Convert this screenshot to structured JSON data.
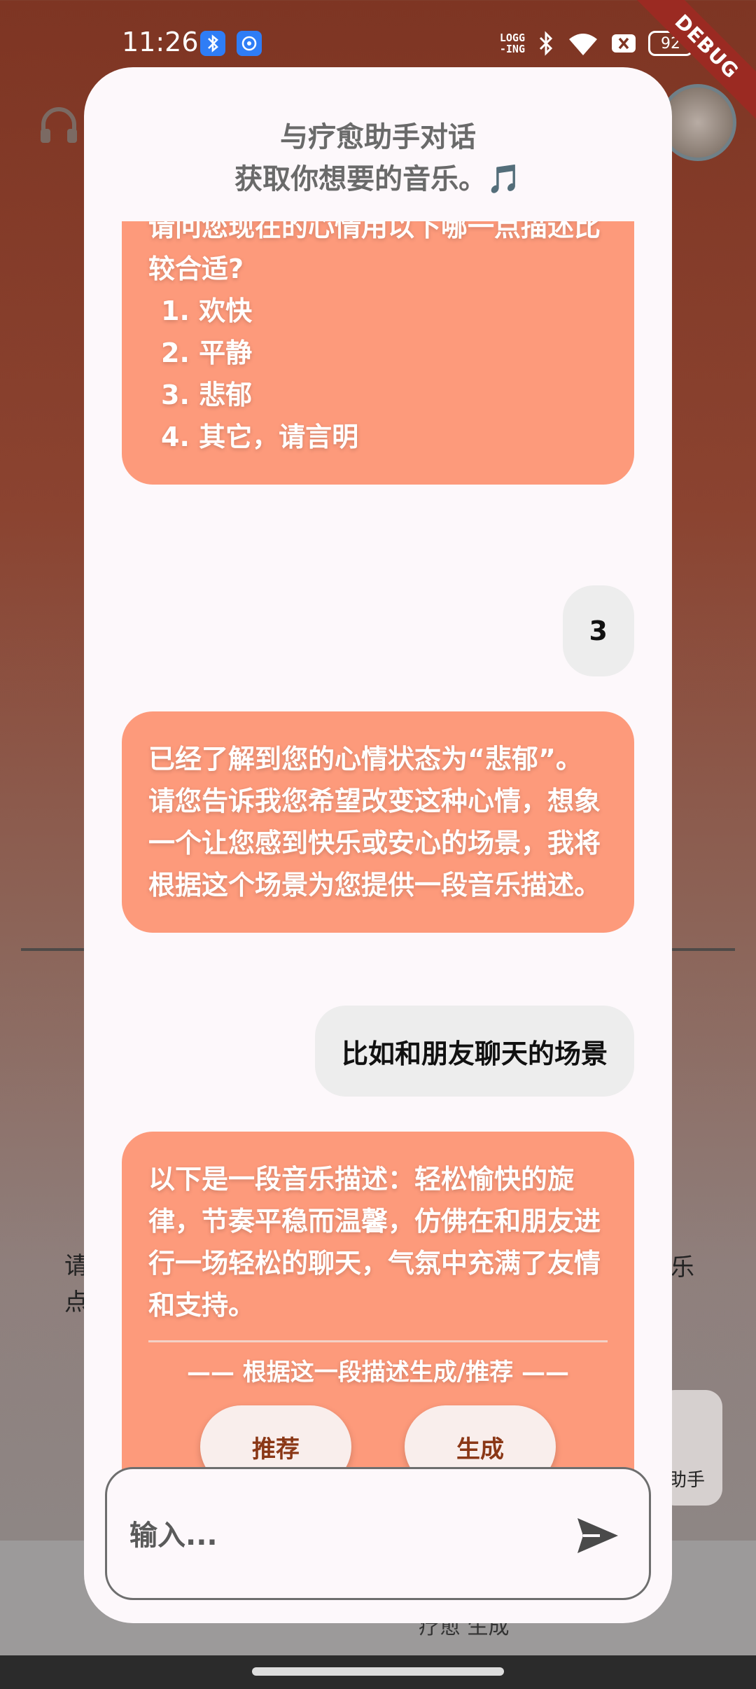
{
  "status_bar": {
    "time": "11:26",
    "logging": [
      "LOGG",
      "-ING"
    ],
    "battery": "92",
    "debug_banner": "DEBUG"
  },
  "background": {
    "text_left": "请点",
    "text_right": "乐",
    "fab_label": "助手",
    "bottom_label": "疗愈 生成"
  },
  "dialog": {
    "title_line1": "与疗愈助手对话",
    "title_line2": "获取你想要的音乐。🎵",
    "messages": {
      "bot1_intro": "请问您现在的心情用以下哪一点描述比较合适?",
      "bot1_options": [
        "1. 欢快",
        "2. 平静",
        "3. 悲郁",
        "4. 其它，请言明"
      ],
      "user1": "3",
      "bot2": "已经了解到您的心情状态为“悲郁”。请您告诉我您希望改变这种心情，想象一个让您感到快乐或安心的场景，我将根据这个场景为您提供一段音乐描述。",
      "user2": "比如和朋友聊天的场景",
      "bot3": "以下是一段音乐描述：轻松愉快的旋律，节奏平稳而温馨，仿佛在和朋友进行一场轻松的聊天，气氛中充满了友情和支持。",
      "bot3_hint": "—— 根据这一段描述生成/推荐 ——",
      "recommend_button": "推荐",
      "generate_button": "生成"
    },
    "input": {
      "placeholder": "输入..."
    }
  },
  "colors": {
    "bot_bubble": "#fd9a7b",
    "user_bubble": "#ededed",
    "action_button_text": "#8a3716",
    "dialog_bg": "#fdf8fb"
  },
  "icons": [
    "bluetooth-icon",
    "app-notify-icon",
    "bluetooth-status-icon",
    "wifi-icon",
    "close-box-icon",
    "headphone-icon",
    "send-icon"
  ]
}
